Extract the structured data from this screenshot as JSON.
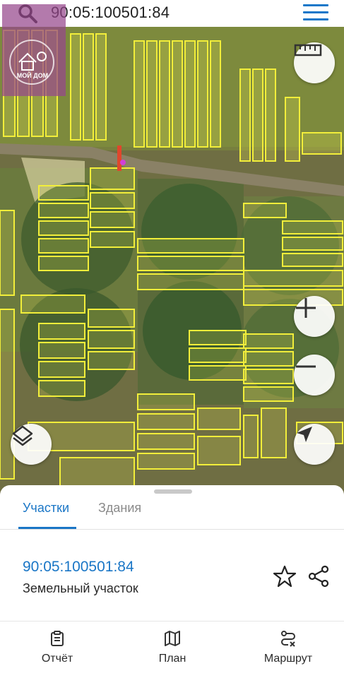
{
  "search": {
    "query": "90:05:100501:84"
  },
  "logo": {
    "text": "МОЙ ДОМ"
  },
  "map": {
    "controls": {
      "ruler_icon": "ruler-icon",
      "zoom_in_icon": "plus-icon",
      "zoom_out_icon": "minus-icon",
      "layers_icon": "layers-icon",
      "locate_icon": "navigation-arrow-icon"
    }
  },
  "tabs": [
    {
      "label": "Участки",
      "active": true
    },
    {
      "label": "Здания",
      "active": false
    }
  ],
  "parcel": {
    "cadastral_number": "90:05:100501:84",
    "type": "Земельный участок"
  },
  "bottom_nav": [
    {
      "label": "Отчёт",
      "icon": "clipboard-icon"
    },
    {
      "label": "План",
      "icon": "map-icon"
    },
    {
      "label": "Маршрут",
      "icon": "route-icon"
    }
  ],
  "colors": {
    "accent": "#1a76c6",
    "parcel_outline": "#f2ee3a",
    "logo_overlay": "#96468c"
  }
}
